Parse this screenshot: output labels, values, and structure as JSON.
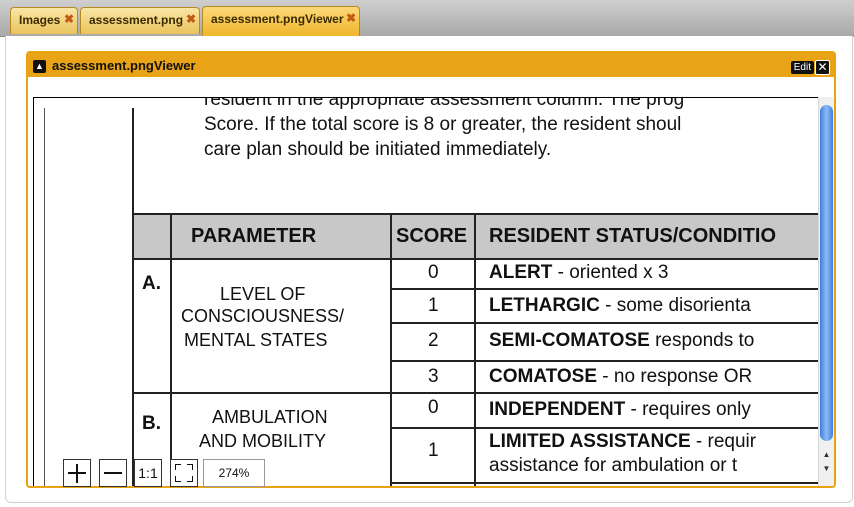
{
  "tabs": [
    {
      "label": "Images",
      "active": false
    },
    {
      "label": "assessment.png",
      "active": false
    },
    {
      "label": "assessment.pngViewer",
      "active": true
    }
  ],
  "viewer": {
    "title": "assessment.pngViewer",
    "edit_label": "Edit",
    "collapse_icon": "triangle-up-icon",
    "close_icon": "close-icon"
  },
  "document": {
    "intro_lines": [
      "resident in the appropriate assessment column. The prog",
      "Score. If the total score is 8 or greater, the resident shoul",
      "care plan should be initiated immediately."
    ],
    "headers": [
      "PARAMETER",
      "SCORE",
      "RESIDENT STATUS/CONDITIO"
    ],
    "sections": [
      {
        "letter": "A.",
        "parameter": [
          "LEVEL OF",
          "CONSCIOUSNESS/",
          "MENTAL STATES"
        ],
        "rows": [
          {
            "score": "0",
            "status_bold": "ALERT",
            "status_rest": " - oriented  x  3"
          },
          {
            "score": "1",
            "status_bold": "LETHARGIC",
            "status_rest": " - some disorienta"
          },
          {
            "score": "2",
            "status_bold": "SEMI-COMATOSE",
            "status_rest": " responds to"
          },
          {
            "score": "3",
            "status_bold": "COMATOSE",
            "status_rest": " - no response OR"
          }
        ]
      },
      {
        "letter": "B.",
        "parameter": [
          "AMBULATION",
          "AND MOBILITY"
        ],
        "rows": [
          {
            "score": "0",
            "status_bold": "INDEPENDENT",
            "status_rest": " - requires only"
          },
          {
            "score": "1",
            "status_bold": "LIMITED ASSISTANCE",
            "status_rest": " - requir",
            "status_line2": "assistance for ambulation or t"
          }
        ]
      }
    ]
  },
  "zoom": {
    "zoom_in_icon": "plus-icon",
    "zoom_out_icon": "minus-icon",
    "actual_size_label": "1:1",
    "fit_icon": "fit-to-window-icon",
    "level": "274%"
  },
  "colors": {
    "accent": "#e8a316",
    "tab": "#f0b52b",
    "scroll_thumb": "#3e7fe0"
  }
}
